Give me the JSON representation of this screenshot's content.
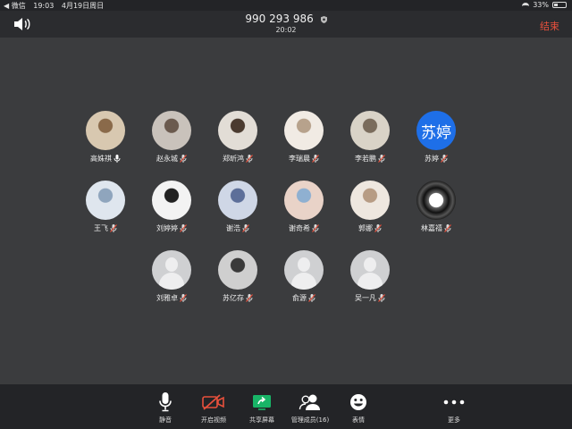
{
  "status_bar": {
    "back_app": "◀ 微信",
    "time": "19:03",
    "date": "4月19日周日",
    "battery": "33%",
    "battery_level": 0.33
  },
  "header": {
    "meeting_id": "990 293 986",
    "elapsed": "20:02",
    "end_label": "结束"
  },
  "participants": [
    {
      "name": "高姝祺",
      "mic": "on",
      "avatar": "photo"
    },
    {
      "name": "赵永城",
      "mic": "muted",
      "avatar": "photo"
    },
    {
      "name": "郑昕鸿",
      "mic": "muted",
      "avatar": "photo"
    },
    {
      "name": "李瑞晨",
      "mic": "muted",
      "avatar": "photo"
    },
    {
      "name": "李若鹏",
      "mic": "muted",
      "avatar": "photo"
    },
    {
      "name": "苏婷",
      "mic": "muted",
      "avatar": "initials",
      "initials": "苏婷"
    },
    {
      "name": "王飞",
      "mic": "muted",
      "avatar": "photo"
    },
    {
      "name": "刘婷婷",
      "mic": "muted",
      "avatar": "photo"
    },
    {
      "name": "谢浩",
      "mic": "muted",
      "avatar": "photo"
    },
    {
      "name": "谢奇希",
      "mic": "muted",
      "avatar": "photo"
    },
    {
      "name": "郭娜",
      "mic": "muted",
      "avatar": "photo"
    },
    {
      "name": "林嘉禧",
      "mic": "muted",
      "avatar": "photo"
    },
    {
      "name": "刘雅卓",
      "mic": "muted",
      "avatar": "default"
    },
    {
      "name": "苏亿存",
      "mic": "muted",
      "avatar": "photo"
    },
    {
      "name": "俞源",
      "mic": "muted",
      "avatar": "default"
    },
    {
      "name": "吴一凡",
      "mic": "muted",
      "avatar": "default"
    }
  ],
  "toolbar": {
    "mute": "静音",
    "start_video": "开启视频",
    "share_screen": "共享屏幕",
    "manage_members": "管理成员(16)",
    "reactions": "表情",
    "more": "更多"
  },
  "colors": {
    "end": "#e8503c",
    "share_icon": "#18b567",
    "video_off": "#e8503c",
    "initials_avatar": "#1e6fe8"
  }
}
